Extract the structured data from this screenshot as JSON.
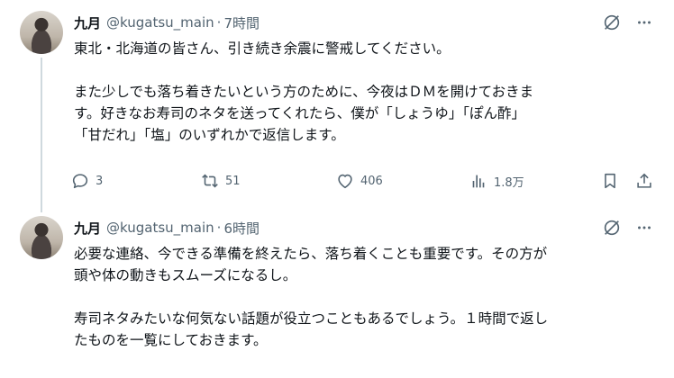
{
  "colors": {
    "text": "#0f1419",
    "muted": "#536471",
    "line": "#cfd9de"
  },
  "tweets": [
    {
      "name": "九月",
      "handle": "@kugatsu_main",
      "dot": "·",
      "time": "7時間",
      "lines": [
        "東北・北海道の皆さん、引き続き余震に警戒してください。",
        "",
        "また少しでも落ち着きたいという方のために、今夜はＤＭを開けておきま",
        "す。好きなお寿司のネタを送ってくれたら、僕が「しょうゆ」「ぽん酢」",
        "「甘だれ」「塩」のいずれかで返信します。"
      ],
      "actions": {
        "replies": "3",
        "reposts": "51",
        "likes": "406",
        "views": "1.8万"
      }
    },
    {
      "name": "九月",
      "handle": "@kugatsu_main",
      "dot": "·",
      "time": "6時間",
      "lines": [
        "必要な連絡、今できる準備を終えたら、落ち着くことも重要です。その方が",
        "頭や体の動きもスムーズになるし。",
        "",
        "寿司ネタみたいな何気ない話題が役立つこともあるでしょう。１時間で返し",
        "たものを一覧にしておきます。"
      ]
    }
  ],
  "icons": [
    "grok-icon",
    "more-icon",
    "reply-icon",
    "repost-icon",
    "like-icon",
    "views-icon",
    "bookmark-icon",
    "share-icon"
  ]
}
